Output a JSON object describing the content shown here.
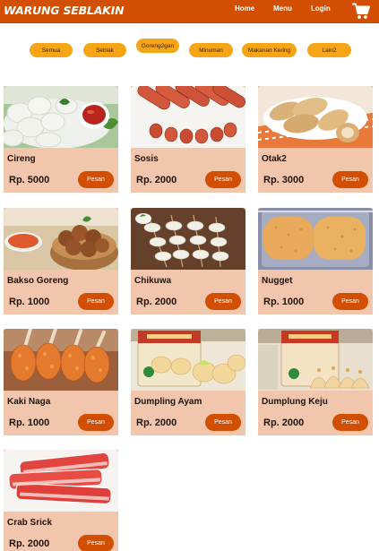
{
  "header": {
    "brand": "WARUNG SEBLAKIN",
    "nav": [
      "Home",
      "Menu",
      "Login"
    ],
    "cart_icon": "shopping-cart-icon"
  },
  "colors": {
    "header_bg": "#d24e00",
    "chip_bg": "#f5a516",
    "card_bg": "#f2c6ac",
    "button_bg": "#d24e00"
  },
  "filters": [
    "Semua",
    "Seblak",
    "Goreng2gan",
    "Minuman",
    "Makanan Kering",
    "Lain2"
  ],
  "products": [
    {
      "name": "Cireng",
      "price": "Rp. 5000",
      "button": "Pesan",
      "image": "cireng-photo"
    },
    {
      "name": "Sosis",
      "price": "Rp. 2000",
      "button": "Pesan",
      "image": "sosis-photo"
    },
    {
      "name": "Otak2",
      "price": "Rp. 3000",
      "button": "Pesan",
      "image": "otak2-photo"
    },
    {
      "name": "Bakso Goreng",
      "price": "Rp. 1000",
      "button": "Pesan",
      "image": "bakso-goreng-photo"
    },
    {
      "name": "Chikuwa",
      "price": "Rp. 2000",
      "button": "Pesan",
      "image": "chikuwa-photo"
    },
    {
      "name": "Nugget",
      "price": "Rp. 1000",
      "button": "Pesan",
      "image": "nugget-photo"
    },
    {
      "name": "Kaki Naga",
      "price": "Rp. 1000",
      "button": "Pesan",
      "image": "kaki-naga-photo"
    },
    {
      "name": "Dumpling Ayam",
      "price": "Rp. 2000",
      "button": "Pesan",
      "image": "dumpling-ayam-photo"
    },
    {
      "name": "Dumplung Keju",
      "price": "Rp. 2000",
      "button": "Pesan",
      "image": "dumplung-keju-photo"
    },
    {
      "name": "Crab Srick",
      "price": "Rp. 2000",
      "button": "Pesan",
      "image": "crab-stick-photo"
    }
  ]
}
